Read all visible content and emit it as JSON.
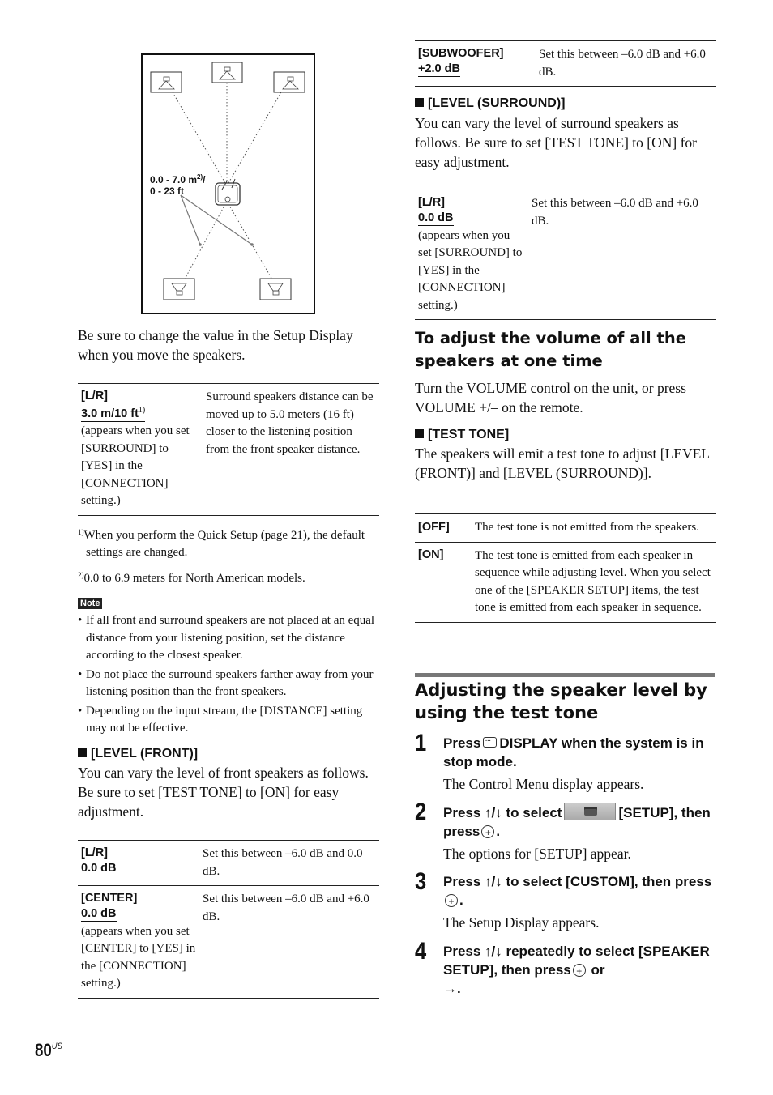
{
  "diagram": {
    "range_label_line1": "0.0 - 7.0 m",
    "range_label_sup": "2)",
    "range_label_slash": "/",
    "range_label_line2": "0 - 23 ft",
    "speakers": [
      "front-left",
      "center",
      "front-right",
      "surround-left",
      "surround-right"
    ],
    "listener_icon": "listener-chair-icon"
  },
  "left": {
    "intro": "Be sure to change the value in the Setup Display when you move the speakers.",
    "distance_table": [
      {
        "label": "[L/R]",
        "value": "3.0 m/10 ft",
        "value_sup": "1)",
        "note": "(appears when you set [SURROUND] to [YES] in the [CONNECTION] setting.)",
        "description": "Surround speakers distance can be moved up to 5.0 meters (16 ft) closer to the listening position from the front speaker distance."
      }
    ],
    "footnotes": [
      {
        "mark": "1)",
        "text": "When you perform the Quick Setup (page 21), the default settings are changed."
      },
      {
        "mark": "2)",
        "text": "0.0 to 6.9 meters for North American models."
      }
    ],
    "note_label": "Note",
    "notes": [
      "If all front and surround speakers are not placed at an equal distance from your listening position, set the distance according to the closest speaker.",
      "Do not place the surround speakers farther away from your listening position than the front speakers.",
      "Depending on the input stream, the [DISTANCE] setting may not be effective."
    ],
    "level_front": {
      "heading": "[LEVEL (FRONT)]",
      "body": "You can vary the level of front speakers as follows. Be sure to set [TEST TONE] to [ON] for easy adjustment.",
      "table": [
        {
          "label": "[L/R]",
          "value": "0.0 dB",
          "note": "",
          "description": "Set this between –6.0 dB and 0.0 dB."
        },
        {
          "label": "[CENTER]",
          "value": "0.0 dB",
          "note": "(appears when you set [CENTER] to [YES] in the [CONNECTION] setting.)",
          "description": "Set this between –6.0 dB and +6.0 dB."
        }
      ]
    }
  },
  "right": {
    "subwoofer_table": [
      {
        "label": "[SUBWOOFER]",
        "value": "+2.0 dB",
        "description": "Set this between –6.0 dB and +6.0 dB."
      }
    ],
    "level_surround": {
      "heading": "[LEVEL (SURROUND)]",
      "body": "You can vary the level of surround speakers as follows. Be sure to set [TEST TONE] to [ON] for easy adjustment.",
      "table": [
        {
          "label": "[L/R]",
          "value": "0.0 dB",
          "note": "(appears when you set [SURROUND] to [YES] in the [CONNECTION] setting.)",
          "description": "Set this between –6.0 dB and +6.0 dB."
        }
      ]
    },
    "volume_all": {
      "heading": "To adjust the volume of all the speakers at one time",
      "body": "Turn the VOLUME control on the unit, or press VOLUME +/– on the remote."
    },
    "test_tone": {
      "heading": "[TEST TONE]",
      "body": "The speakers will emit a test tone to adjust [LEVEL (FRONT)] and [LEVEL (SURROUND)].",
      "table": [
        {
          "label": "[OFF]",
          "default": true,
          "description": "The test tone is not emitted from the speakers."
        },
        {
          "label": "[ON]",
          "default": false,
          "description": "The test tone is emitted from each speaker in sequence while adjusting level. When you select one of the [SPEAKER SETUP] items, the test tone is emitted from each speaker in sequence."
        }
      ]
    },
    "section_title": "Adjusting the speaker level by using the test tone",
    "steps": [
      {
        "num": "1",
        "instr_a": "Press",
        "icon": "display-button-icon",
        "instr_b": "DISPLAY when the system is in stop mode.",
        "result": "The Control Menu display appears."
      },
      {
        "num": "2",
        "instr_a": "Press ↑/↓ to select",
        "icon": "setup-toolbox-icon",
        "instr_b": "[SETUP], then press",
        "instr_c": ".",
        "result": "The options for [SETUP] appear."
      },
      {
        "num": "3",
        "instr_a": "Press ↑/↓ to select [CUSTOM], then press",
        "instr_c": ".",
        "result": "The Setup Display appears."
      },
      {
        "num": "4",
        "instr_a": "Press ↑/↓ repeatedly to select [SPEAKER SETUP], then press",
        "instr_b": "or",
        "instr_c": "→."
      }
    ]
  },
  "footer": {
    "page_number": "80",
    "region": "US"
  }
}
